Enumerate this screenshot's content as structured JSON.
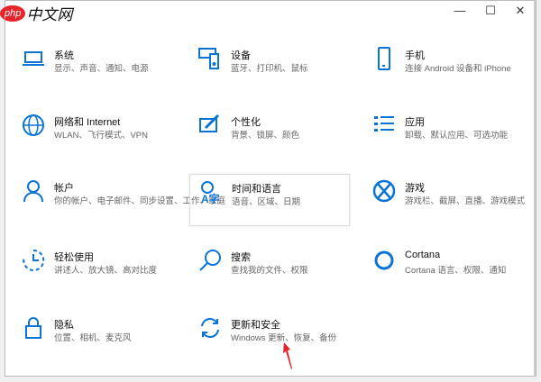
{
  "watermark": {
    "brand": "php",
    "text": "中文网"
  },
  "window": {
    "minimize": "—",
    "maximize": "☐",
    "close": "✕"
  },
  "items": [
    {
      "title": "系统",
      "subtitle": "显示、声音、通知、电源",
      "icon": "laptop-icon"
    },
    {
      "title": "设备",
      "subtitle": "蓝牙、打印机、鼠标",
      "icon": "devices-icon"
    },
    {
      "title": "手机",
      "subtitle": "连接 Android 设备和 iPhone",
      "icon": "phone-icon"
    },
    {
      "title": "网络和 Internet",
      "subtitle": "WLAN、飞行模式、VPN",
      "icon": "globe-icon"
    },
    {
      "title": "个性化",
      "subtitle": "背景、锁屏、颜色",
      "icon": "personalization-icon"
    },
    {
      "title": "应用",
      "subtitle": "卸载、默认应用、可选功能",
      "icon": "apps-icon"
    },
    {
      "title": "帐户",
      "subtitle": "你的帐户、电子邮件、同步设置、工作、家庭",
      "icon": "person-icon"
    },
    {
      "title": "时间和语言",
      "subtitle": "语音、区域、日期",
      "icon": "time-language-icon"
    },
    {
      "title": "游戏",
      "subtitle": "游戏栏、截屏、直播、游戏模式",
      "icon": "xbox-icon"
    },
    {
      "title": "轻松使用",
      "subtitle": "讲述人、放大镜、高对比度",
      "icon": "ease-of-access-icon"
    },
    {
      "title": "搜索",
      "subtitle": "查找我的文件、权限",
      "icon": "search-icon"
    },
    {
      "title": "Cortana",
      "subtitle": "Cortana 语言、权限、通知",
      "icon": "cortana-icon"
    },
    {
      "title": "隐私",
      "subtitle": "位置、相机、麦克风",
      "icon": "lock-icon"
    },
    {
      "title": "更新和安全",
      "subtitle": "Windows 更新、恢复、备份",
      "icon": "sync-icon"
    }
  ],
  "accent": "#0a74d6"
}
